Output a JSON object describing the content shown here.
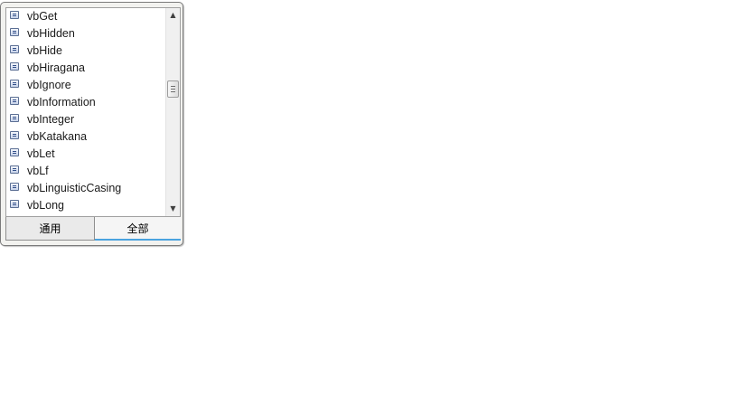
{
  "intellisense": {
    "items": [
      {
        "label": "vbGet",
        "icon": "enum-member-icon"
      },
      {
        "label": "vbHidden",
        "icon": "enum-member-icon"
      },
      {
        "label": "vbHide",
        "icon": "enum-member-icon"
      },
      {
        "label": "vbHiragana",
        "icon": "enum-member-icon"
      },
      {
        "label": "vbIgnore",
        "icon": "enum-member-icon"
      },
      {
        "label": "vbInformation",
        "icon": "enum-member-icon"
      },
      {
        "label": "vbInteger",
        "icon": "enum-member-icon"
      },
      {
        "label": "vbKatakana",
        "icon": "enum-member-icon"
      },
      {
        "label": "vbLet",
        "icon": "enum-member-icon"
      },
      {
        "label": "vbLf",
        "icon": "enum-member-icon"
      },
      {
        "label": "vbLinguisticCasing",
        "icon": "enum-member-icon"
      },
      {
        "label": "vbLong",
        "icon": "enum-member-icon"
      }
    ],
    "tabs": [
      {
        "label": "通用",
        "selected": false
      },
      {
        "label": "全部",
        "selected": true
      }
    ],
    "colors": {
      "selected_tab_underline": "#4aa3df",
      "popup_background": "#f2f2ef"
    },
    "icons": {
      "scroll_up": "scroll-up-arrow-icon",
      "scroll_down": "scroll-down-arrow-icon"
    }
  }
}
